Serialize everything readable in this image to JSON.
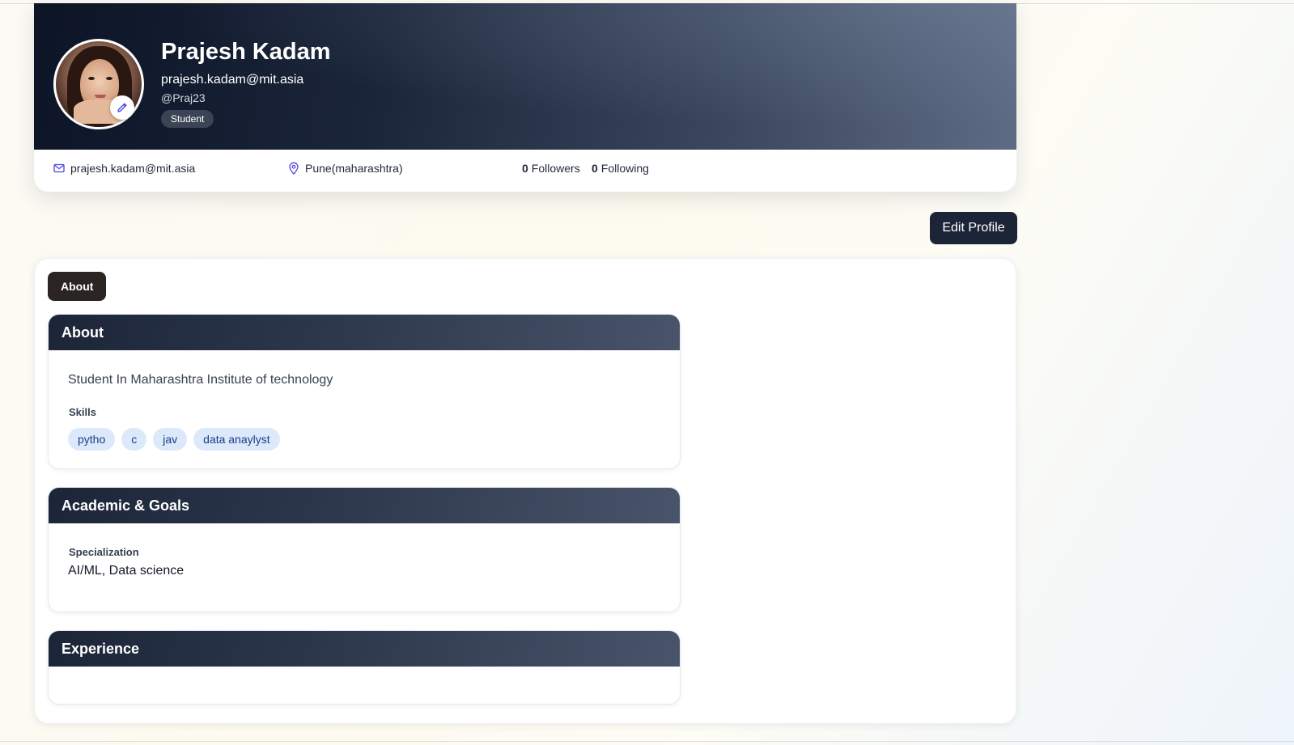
{
  "profile": {
    "name": "Prajesh Kadam",
    "email": "prajesh.kadam@mit.asia",
    "handle": "@Praj23",
    "role": "Student",
    "contact_email": "prajesh.kadam@mit.asia",
    "location": "Pune(maharashtra)",
    "followers_count": "0",
    "followers_label": "Followers",
    "following_count": "0",
    "following_label": "Following"
  },
  "actions": {
    "edit_profile": "Edit Profile"
  },
  "tabs": {
    "active": "About"
  },
  "about": {
    "title": "About",
    "bio": "Student In Maharashtra Institute of technology",
    "skills_label": "Skills",
    "skills": [
      "pytho",
      "c",
      "jav",
      "data anaylyst"
    ]
  },
  "academic": {
    "title": "Academic & Goals",
    "specialization_label": "Specialization",
    "specialization_value": "AI/ML, Data science"
  },
  "experience": {
    "title": "Experience"
  },
  "colors": {
    "banner_dark": "#0c1426",
    "button_dark": "#1c2538",
    "skill_chip_bg": "#dbe9fb",
    "icon_accent": "#4f46e5"
  },
  "icons": {
    "contact": "mail-icon",
    "location": "map-pin-icon",
    "avatar_edit": "pencil-icon"
  }
}
